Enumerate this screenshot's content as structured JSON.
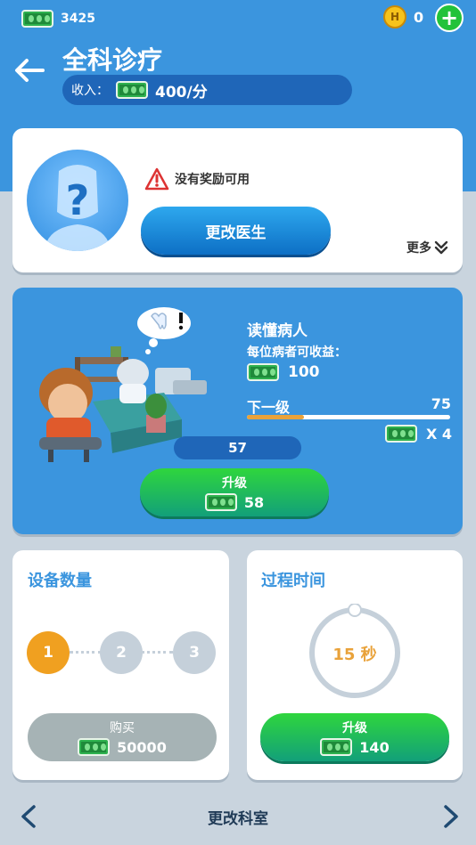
{
  "header": {
    "cash": "3425",
    "coins": "0",
    "coin_symbol": "H",
    "title": "全科诊疗",
    "income_label": "收入：",
    "income_value": "400/分"
  },
  "doctor": {
    "avatar_symbol": "?",
    "warning_text": "没有奖励可用",
    "change_doctor_label": "更改医生",
    "more_label": "更多"
  },
  "treatment": {
    "title": "读懂病人",
    "earn_label": "每位病者可收益：",
    "earn_value": "100",
    "next_level_label": "下一级",
    "next_level_value": "75",
    "level_progress": 0.28,
    "multiplier": "X 4",
    "patients_count": "57",
    "upgrade_label": "升级",
    "upgrade_cost": "58"
  },
  "equipment": {
    "title": "设备数量",
    "slots": [
      "1",
      "2",
      "3"
    ],
    "active_slot": 1,
    "buy_label": "购买",
    "buy_cost": "50000"
  },
  "process": {
    "title": "过程时间",
    "time_label": "15 秒",
    "upgrade_label": "升级",
    "upgrade_cost": "140"
  },
  "footer": {
    "label": "更改科室"
  },
  "colors": {
    "header_blue": "#3b95de",
    "green": "#22c23a",
    "orange": "#f0a020",
    "gray_slot": "#c5d0da"
  }
}
